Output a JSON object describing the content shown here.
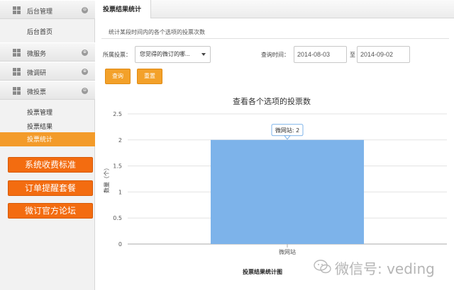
{
  "sidebar": {
    "groups": [
      {
        "label": "后台管理",
        "toggle": "⊖",
        "items": [
          "后台首页"
        ]
      },
      {
        "label": "微服务",
        "toggle": "⊕",
        "items": []
      },
      {
        "label": "微调研",
        "toggle": "⊕",
        "items": []
      },
      {
        "label": "微投票",
        "toggle": "⊖",
        "items": [
          "投票管理",
          "投票结果",
          "投票统计"
        ]
      }
    ],
    "active_item": "投票统计",
    "promo_buttons": [
      "系统收费标准",
      "订单提醒套餐",
      "微订官方论坛"
    ]
  },
  "main": {
    "tab": "投票结果统计",
    "description": "统计某段时间内的各个选项的投票次数",
    "filters": {
      "owner_label": "所属投票：",
      "owner_value": "您觉得的微订的哪...",
      "time_label": "查询时间：",
      "start_date": "2014-08-03",
      "to_label": "至",
      "end_date": "2014-09-02"
    },
    "buttons": {
      "query": "查询",
      "reset": "重置"
    }
  },
  "chart_data": {
    "type": "bar",
    "title": "查看各个选项的投票数",
    "xlabel": "投票结果统计图",
    "ylabel": "数量（个）",
    "categories": [
      "微网站"
    ],
    "values": [
      2
    ],
    "ylim": [
      0,
      2.5
    ],
    "yticks": [
      "0",
      "0.5",
      "1",
      "1.5",
      "2",
      "2.5"
    ],
    "tooltip": "微网站: 2",
    "bar_color": "#7db3ea",
    "grid": true
  },
  "watermark": {
    "text": "微信号: veding"
  }
}
